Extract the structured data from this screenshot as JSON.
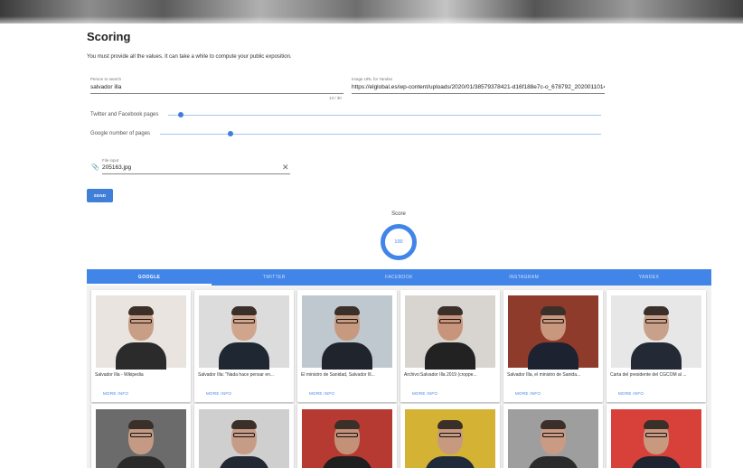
{
  "page": {
    "title": "Scoring",
    "subtitle": "You must provide all the values. It can take a while to compute your public exposition."
  },
  "form": {
    "person_label": "Person to search",
    "person_value": "salvador illa",
    "person_counter": "13 / 30",
    "image_url_label": "Image URL for Yandex",
    "image_url_value": "https://elglobal.es/wp-content/uploads/2020/01/38579378421-d16f188e7c-o_678792_20200110141",
    "twitter_facebook_label": "Twitter and Facebook pages",
    "twitter_facebook_value": 0.03,
    "google_pages_label": "Google number of pages",
    "google_pages_value": 0.16,
    "file_label": "File input",
    "file_value": "205163.jpg",
    "send_label": "SEND"
  },
  "score": {
    "label": "Score",
    "value": "100",
    "fraction": 1.0
  },
  "tabs": [
    {
      "label": "GOOGLE",
      "active": true
    },
    {
      "label": "TWITTER",
      "active": false
    },
    {
      "label": "FACEBOOK",
      "active": false
    },
    {
      "label": "INSTAGRAM",
      "active": false
    },
    {
      "label": "YANDEX",
      "active": false
    }
  ],
  "results": [
    {
      "caption": "Salvador Illa - Wikipedia",
      "more": "MORE INFO"
    },
    {
      "caption": "Salvador Illa: \"Nada hace pensar en...",
      "more": "MORE INFO"
    },
    {
      "caption": "El ministro de Sanidad, Salvador Ill...",
      "more": "MORE INFO"
    },
    {
      "caption": "Archivo:Salvador Illa 2019 (croppe...",
      "more": "MORE INFO"
    },
    {
      "caption": "Salvador Illa, el ministro de Sanida...",
      "more": "MORE INFO"
    },
    {
      "caption": "Carta del presidente del CGCOM al ...",
      "more": "MORE INFO"
    },
    {
      "caption": "",
      "more": ""
    },
    {
      "caption": "",
      "more": ""
    },
    {
      "caption": "",
      "more": ""
    },
    {
      "caption": "",
      "more": ""
    },
    {
      "caption": "",
      "more": ""
    },
    {
      "caption": "",
      "more": ""
    }
  ],
  "colors": {
    "accent": "#4285e8",
    "slider_thumb": "#3f7fd8"
  },
  "icons": {
    "attach": "paperclip-icon",
    "clear": "close-icon"
  }
}
